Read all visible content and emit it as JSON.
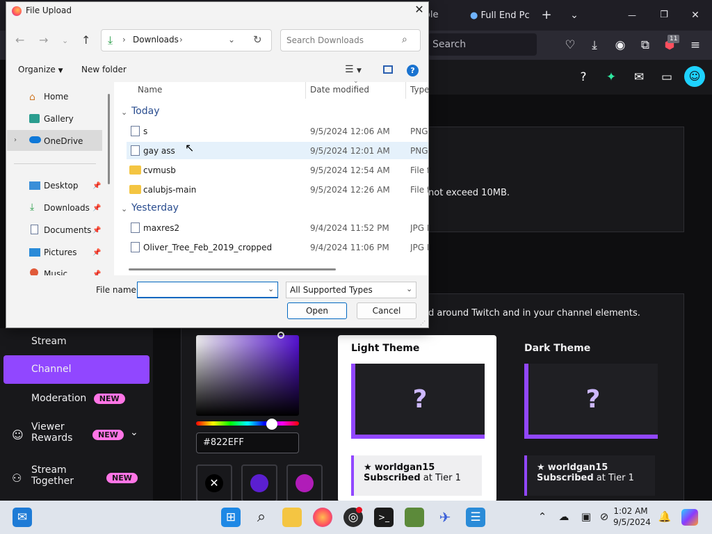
{
  "browser": {
    "tabs": [
      {
        "label": "mhole"
      },
      {
        "label": "Full End Pc"
      }
    ],
    "new_tab_glyph": "+",
    "minimize_glyph": "—",
    "restore_glyph": "❐",
    "close_glyph": "✕",
    "address_placeholder": "Search",
    "extension_badge": "11"
  },
  "page": {
    "upload_note": "not exceed 10MB.",
    "theme_description": "d around Twitch and in your channel elements.",
    "sidebar": {
      "items": [
        {
          "label": "Stream"
        },
        {
          "label": "Channel",
          "active": true
        },
        {
          "label": "Moderation",
          "badge": "NEW"
        },
        {
          "label": "Viewer",
          "label2": "Rewards",
          "badge": "NEW"
        },
        {
          "label": "Stream",
          "label2": "Together",
          "badge": "NEW"
        }
      ]
    },
    "color_picker": {
      "hex_value": "#822EFF",
      "swatches": [
        "#000000",
        "#5b1fd0",
        "#b01cb8"
      ]
    },
    "light_theme": {
      "title": "Light Theme",
      "username": "worldgan15",
      "subscribed": "Subscribed",
      "tier": " at Tier 1"
    },
    "dark_theme": {
      "title": "Dark Theme",
      "username": "worldgan15",
      "subscribed": "Subscribed",
      "tier": " at Tier 1"
    }
  },
  "dialog": {
    "title": "File Upload",
    "address": {
      "location": "Downloads"
    },
    "search_placeholder": "Search Downloads",
    "toolbar": {
      "organize": "Organize",
      "new_folder": "New folder"
    },
    "nav": [
      {
        "label": "Home"
      },
      {
        "label": "Gallery"
      },
      {
        "label": "OneDrive"
      },
      {
        "label": "Desktop"
      },
      {
        "label": "Downloads"
      },
      {
        "label": "Documents"
      },
      {
        "label": "Pictures"
      },
      {
        "label": "Music"
      }
    ],
    "columns": {
      "name": "Name",
      "date": "Date modified",
      "type": "Type"
    },
    "groups": [
      {
        "label": "Today",
        "files": [
          {
            "name": "s",
            "date": "9/5/2024 12:06 AM",
            "type": "PNG"
          },
          {
            "name": "gay ass",
            "date": "9/5/2024 12:01 AM",
            "type": "PNG"
          },
          {
            "name": "cvmusb",
            "date": "9/5/2024 12:54 AM",
            "type": "File fo"
          },
          {
            "name": "calubjs-main",
            "date": "9/5/2024 12:26 AM",
            "type": "File fo"
          }
        ]
      },
      {
        "label": "Yesterday",
        "files": [
          {
            "name": "maxres2",
            "date": "9/4/2024 11:52 PM",
            "type": "JPG F"
          },
          {
            "name": "Oliver_Tree_Feb_2019_cropped",
            "date": "9/4/2024 11:06 PM",
            "type": "JPG F"
          }
        ]
      }
    ],
    "file_name_label": "File name:",
    "file_name_value": "",
    "file_type": "All Supported Types",
    "open_label": "Open",
    "cancel_label": "Cancel"
  },
  "taskbar": {
    "time": "1:02 AM",
    "date": "9/5/2024"
  }
}
